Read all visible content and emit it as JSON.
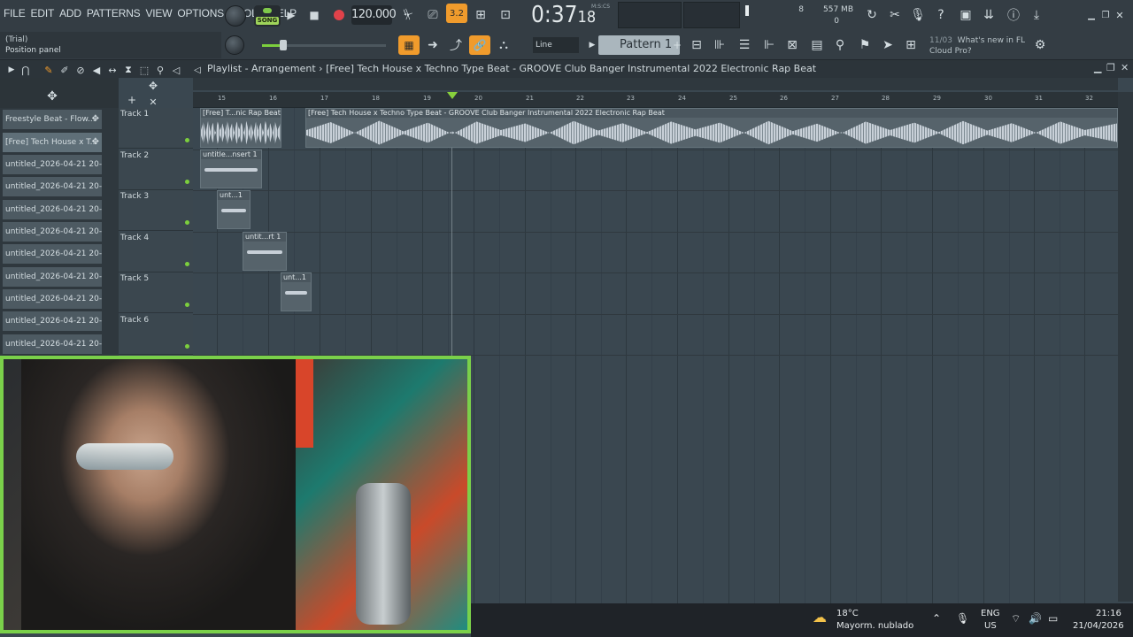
{
  "menu": [
    "FILE",
    "EDIT",
    "ADD",
    "PATTERNS",
    "VIEW",
    "OPTIONS",
    "TOOLS",
    "HELP"
  ],
  "transport": {
    "mode_label": "SONG",
    "tempo": "120.000",
    "time_main": "0:37",
    "time_ms": "18",
    "time_unit": "M:S:CS",
    "cpu_voices": "8",
    "ram": "557 MB",
    "cpu_extra": "0",
    "step_value": "3.2"
  },
  "hint": {
    "line1": "(Trial)",
    "line2": "Position panel"
  },
  "toolbar2": {
    "snap": "Line",
    "pattern": "Pattern 1"
  },
  "news": {
    "date": "11/03",
    "line1": "What's new in FL",
    "line2": "Cloud Pro?"
  },
  "playlist": {
    "title": "Playlist - Arrangement",
    "project": "[Free] Tech House x Techno Type Beat - GROOVE  Club Banger Instrumental 2022  Electronic Rap Beat"
  },
  "picker": [
    "Freestyle Beat - Flow...",
    "[Free] Tech House x T...",
    "untitled_2026-04-21 20-...",
    "untitled_2026-04-21 20-...",
    "untitled_2026-04-21 20-...",
    "untitled_2026-04-21 20-...",
    "untitled_2026-04-21 20-...",
    "untitled_2026-04-21 20-...",
    "untitled_2026-04-21 20-...",
    "untitled_2026-04-21 20-...",
    "untitled_2026-04-21 20-..."
  ],
  "ruler": [
    "15",
    "16",
    "17",
    "18",
    "19",
    "20",
    "21",
    "22",
    "23",
    "24",
    "25",
    "26",
    "27",
    "28",
    "29",
    "30",
    "31",
    "32"
  ],
  "tracks": [
    "Track 1",
    "Track 2",
    "Track 3",
    "Track 4",
    "Track 5",
    "Track 6"
  ],
  "clips": {
    "c1": "[Free] T...nic Rap Beat",
    "c2": "[Free] Tech House x Techno Type Beat - GROOVE  Club Banger Instrumental 2022  Electronic Rap Beat",
    "c3": "untitle...nsert 1",
    "c4": "unt...1",
    "c5": "untit...rt 1",
    "c6": "unt...1"
  },
  "taskbar": {
    "temp": "18°C",
    "weather": "Mayorm. nublado",
    "lang1": "ENG",
    "lang2": "US",
    "time": "21:16",
    "date": "21/04/2026"
  },
  "colors": {
    "accent_green": "#7ccf3d",
    "accent_orange": "#f09b2c",
    "record_red": "#e0424a"
  }
}
